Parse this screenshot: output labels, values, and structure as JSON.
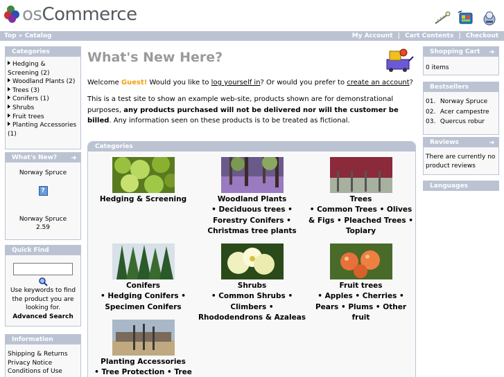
{
  "header": {
    "logo_prefix": "os",
    "logo_main": "Commerce",
    "icons": [
      "checkout-wand-icon",
      "shopping-cart-icon",
      "account-icon"
    ]
  },
  "navbar": {
    "breadcrumb_top": "Top",
    "breadcrumb_sep": "»",
    "breadcrumb_catalog": "Catalog",
    "my_account": "My Account",
    "cart_contents": "Cart Contents",
    "checkout": "Checkout",
    "divider": "|"
  },
  "categories_box": {
    "title": "Categories",
    "items": [
      {
        "label": "Hedging & Screening (2)"
      },
      {
        "label": "Woodland Plants (2)"
      },
      {
        "label": "Trees (3)"
      },
      {
        "label": "Conifers (1)"
      },
      {
        "label": "Shrubs"
      },
      {
        "label": "Fruit trees"
      },
      {
        "label": "Planting Accessories (1)"
      }
    ]
  },
  "whats_new_box": {
    "title": "What's New?",
    "product_name": "Norway Spruce",
    "product_name_below": "Norway Spruce",
    "price": "2.59"
  },
  "quick_find": {
    "title": "Quick Find",
    "input_value": "",
    "help": "Use keywords to find the product you are looking for.",
    "advanced": "Advanced Search"
  },
  "information_box": {
    "title": "Information",
    "items": [
      "Shipping & Returns",
      "Privacy Notice",
      "Conditions of Use"
    ]
  },
  "shopping_cart_box": {
    "title": "Shopping Cart",
    "content": "0 items"
  },
  "bestsellers_box": {
    "title": "Bestsellers",
    "items": [
      {
        "rank": "01.",
        "name": "Norway Spruce"
      },
      {
        "rank": "02.",
        "name": "Acer campestre"
      },
      {
        "rank": "03.",
        "name": "Quercus robur"
      }
    ]
  },
  "reviews_box": {
    "title": "Reviews",
    "content": "There are currently no product reviews"
  },
  "languages_box": {
    "title": "Languages"
  },
  "main": {
    "title": "What's New Here?",
    "welcome_prefix": "Welcome ",
    "guest": "Guest!",
    "welcome_mid": " Would you like to ",
    "login_link": "log yourself in",
    "welcome_mid2": "? Or would you prefer to ",
    "create_link": "create an account",
    "welcome_end": "?",
    "intro_plain": "This is a test site to show an example web-site, products shown are for demonstrational purposes, ",
    "intro_bold": "any products purchased will not be delivered nor will the customer be billed",
    "intro_end": ". Any information seen on these products is to be treated as fictional."
  },
  "catalog": {
    "title": "Categories",
    "cells": [
      {
        "name": "Hedging & Screening",
        "subs": ""
      },
      {
        "name": "Woodland Plants",
        "subs": "• Deciduous trees • Forestry Conifers • Christmas tree plants"
      },
      {
        "name": "Trees",
        "subs": "• Common Trees • Olives & Figs • Pleached Trees • Topiary"
      },
      {
        "name": "Conifers",
        "subs": "• Hedging Conifers • Specimen Conifers"
      },
      {
        "name": "Shrubs",
        "subs": "• Common Shrubs • Climbers • Rhododendrons & Azaleas"
      },
      {
        "name": "Fruit trees",
        "subs": "• Apples • Cherries • Pears • Plums • Other fruit"
      },
      {
        "name": "Planting Accessories",
        "subs": "• Tree Protection • Tree"
      }
    ]
  },
  "colors": {
    "bar": "#bbc3d3",
    "box_bg": "#f8f8f9",
    "guest": "#f0a010",
    "title_gray": "#9a9a9a"
  }
}
